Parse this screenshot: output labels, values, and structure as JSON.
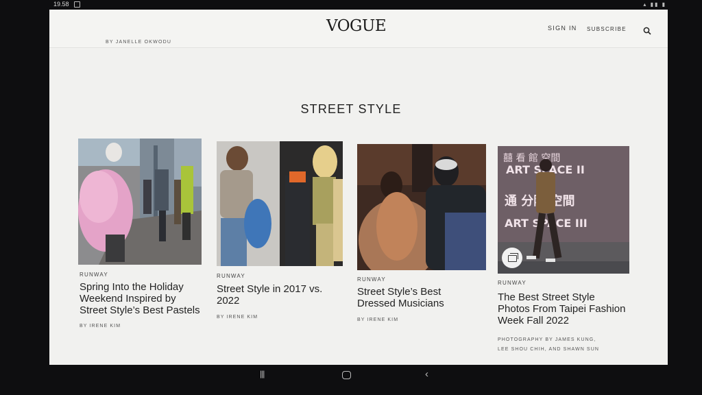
{
  "status": {
    "time": "19.58"
  },
  "header": {
    "logo": "VOGUE",
    "sign_in": "SIGN IN",
    "subscribe": "SUBSCRIBE"
  },
  "article": {
    "byline": "BY JANELLE OKWODU"
  },
  "section": {
    "title": "STREET STYLE"
  },
  "cards": [
    {
      "category": "RUNWAY",
      "title": "Spring Into the Holiday Weekend Inspired by Street Style’s Best Pastels",
      "author": "BY IRENE KIM"
    },
    {
      "category": "RUNWAY",
      "title": "Street Style in 2017 vs. 2022",
      "author": "BY IRENE KIM"
    },
    {
      "category": "RUNWAY",
      "title": "Street Style’s Best Dressed Musicians",
      "author": "BY IRENE KIM"
    },
    {
      "category": "RUNWAY",
      "title": "The Best Street Style Photos From Taipei Fashion Week Fall 2022",
      "author_line1": "PHOTOGRAPHY BY JAMES KUNG,",
      "author_line2": "LEE SHOU CHIH, AND SHAWN SUN",
      "sign_text": [
        "ART SPACE II",
        "ART SPACE III"
      ]
    }
  ],
  "icons": {
    "search": "search-icon",
    "gallery": "gallery-icon",
    "nav": [
      "recent-apps-icon",
      "home-icon",
      "back-icon"
    ]
  }
}
